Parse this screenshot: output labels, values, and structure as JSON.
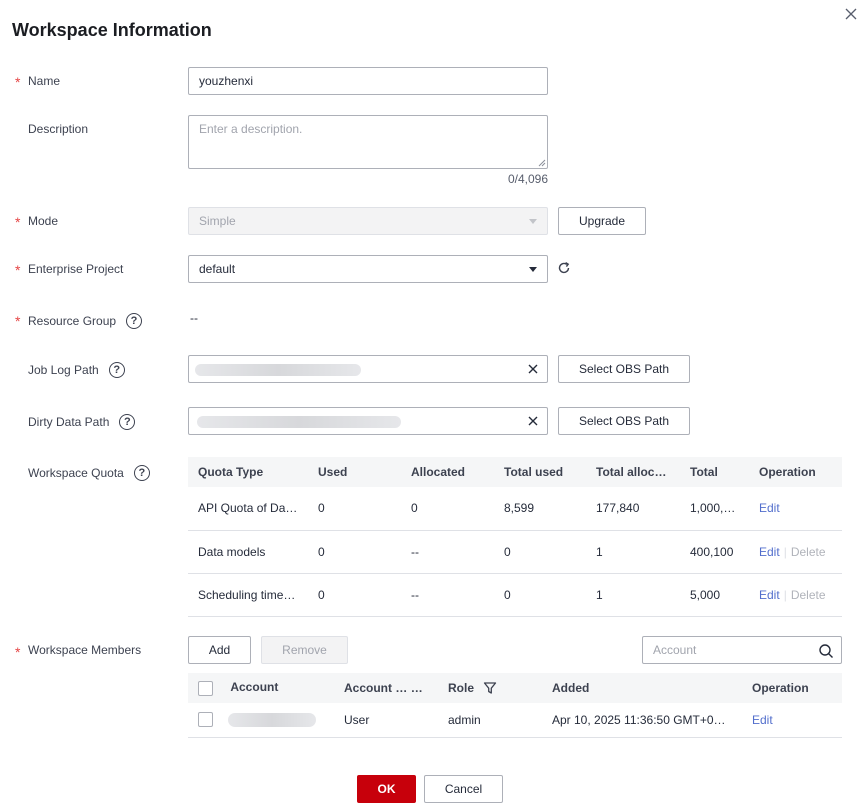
{
  "dialog": {
    "title": "Workspace Information",
    "close_icon": "close-icon"
  },
  "form": {
    "name": {
      "label": "Name",
      "value": "youzhenxi",
      "required": "*"
    },
    "description": {
      "label": "Description",
      "placeholder": "Enter a description.",
      "counter": "0/4,096"
    },
    "mode": {
      "label": "Mode",
      "value": "Simple",
      "upgrade_label": "Upgrade",
      "required": "*"
    },
    "enterprise_project": {
      "label": "Enterprise Project",
      "value": "default",
      "required": "*"
    },
    "resource_group": {
      "label": "Resource Group",
      "value": "--",
      "required": "*"
    },
    "job_log_path": {
      "label": "Job Log Path",
      "button": "Select OBS Path"
    },
    "dirty_data_path": {
      "label": "Dirty Data Path",
      "button": "Select OBS Path"
    },
    "workspace_quota": {
      "label": "Workspace Quota"
    },
    "workspace_members": {
      "label": "Workspace Members",
      "required": "*"
    },
    "help_glyph": "?"
  },
  "quota_table": {
    "headers": [
      "Quota Type",
      "Used",
      "Allocated",
      "Total used",
      "Total alloc…",
      "Total",
      "Operation"
    ],
    "rows": [
      {
        "type": "API Quota of Da…",
        "used": "0",
        "allocated": "0",
        "total_used": "8,599",
        "total_alloc": "177,840",
        "total": "1,000,…",
        "edit": "Edit",
        "delete": ""
      },
      {
        "type": "Data models",
        "used": "0",
        "allocated": "--",
        "total_used": "0",
        "total_alloc": "1",
        "total": "400,100",
        "edit": "Edit",
        "delete": "Delete"
      },
      {
        "type": "Scheduling time…",
        "used": "0",
        "allocated": "--",
        "total_used": "0",
        "total_alloc": "1",
        "total": "5,000",
        "edit": "Edit",
        "delete": "Delete"
      }
    ]
  },
  "members": {
    "add_label": "Add",
    "remove_label": "Remove",
    "search_placeholder": "Account",
    "headers": [
      "Account",
      "Account …",
      "Role",
      "Added",
      "Operation"
    ],
    "rows": [
      {
        "account_type": "User",
        "role": "admin",
        "added": "Apr 10, 2025 11:36:50 GMT+0…",
        "edit": "Edit"
      }
    ]
  },
  "footer": {
    "ok_label": "OK",
    "cancel_label": "Cancel"
  },
  "colors": {
    "primary": "#c7000b",
    "link": "#526ecc",
    "required": "#e54545"
  }
}
